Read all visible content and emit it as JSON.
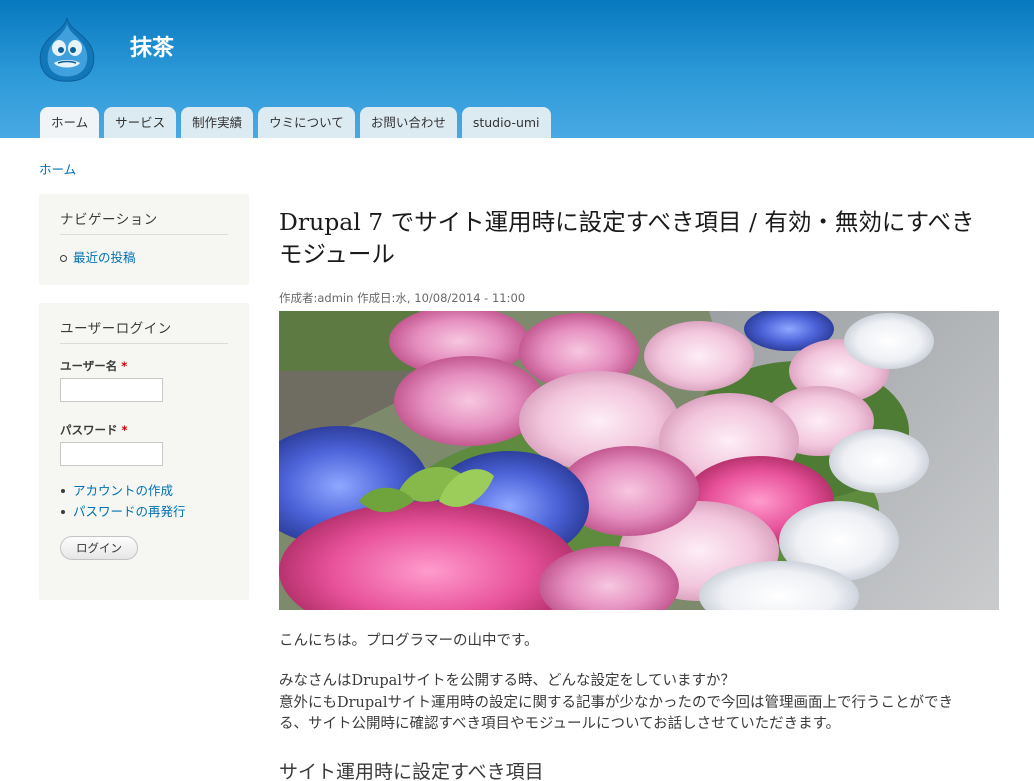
{
  "site": {
    "name": "抹茶"
  },
  "main_menu": [
    {
      "label": "ホーム",
      "active": true
    },
    {
      "label": "サービス"
    },
    {
      "label": "制作実績"
    },
    {
      "label": "ウミについて"
    },
    {
      "label": "お問い合わせ"
    },
    {
      "label": "studio-umi"
    }
  ],
  "breadcrumb": {
    "home": "ホーム"
  },
  "navigation_block": {
    "title": "ナビゲーション",
    "items": [
      "最近の投稿"
    ]
  },
  "login_block": {
    "title": "ユーザーログイン",
    "username_label": "ユーザー名",
    "password_label": "パスワード",
    "required_mark": "*",
    "username_value": "",
    "password_value": "",
    "links": [
      "アカウントの作成",
      "パスワードの再発行"
    ],
    "submit_label": "ログイン"
  },
  "article": {
    "title": "Drupal 7 でサイト運用時に設定すべき項目 / 有効・無効にすべきモジュール",
    "submitted": "作成者:admin 作成日:水, 10/08/2014 - 11:00",
    "paragraphs": [
      "こんにちは。プログラマーの山中です。",
      "みなさんはDrupalサイトを公開する時、どんな設定をしていますか？",
      "意外にもDrupalサイト運用時の設定に関する記事が少なかったので今回は管理画面上で行うことができる、サイト公開時に確認すべき項目やモジュールについてお話しさせていただきます。"
    ],
    "subheading": "サイト運用時に設定すべき項目"
  },
  "colors": {
    "header_top": "#0779bf",
    "header_bottom": "#48a9e4",
    "link": "#0071b3",
    "sidebar_bg": "#f6f6f2",
    "required": "#cc0000"
  }
}
